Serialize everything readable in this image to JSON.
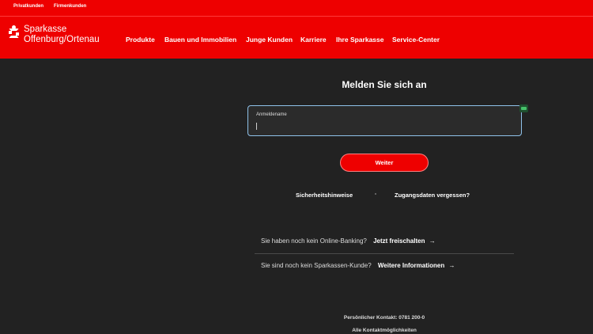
{
  "topbar": {
    "segments": [
      {
        "label": "Privatkunden"
      },
      {
        "label": "Firmenkunden"
      }
    ]
  },
  "brand": {
    "line1": "Sparkasse",
    "line2": "Offenburg/Ortenau",
    "color": "#ee0000"
  },
  "nav": {
    "items": [
      {
        "label": "Produkte"
      },
      {
        "label": "Bauen und Immobilien"
      },
      {
        "label": "Junge Kunden"
      },
      {
        "label": "Karriere"
      },
      {
        "label": "Ihre Sparkasse"
      },
      {
        "label": "Service-Center"
      }
    ]
  },
  "login": {
    "title": "Melden Sie sich an",
    "username_label": "Anmeldename",
    "username_value": "",
    "submit_label": "Weiter"
  },
  "links": {
    "security": "Sicherheitshinweise",
    "forgot": "Zugangsdaten vergessen?"
  },
  "rows": [
    {
      "text": "Sie haben noch kein Online-Banking?",
      "cta": "Jetzt freischalten",
      "arrow": "→"
    },
    {
      "text": "Sie sind noch kein Sparkassen-Kunde?",
      "cta": "Weitere Informationen",
      "arrow": "→"
    }
  ],
  "footer": {
    "contact": "Persönlicher Kontakt: 0781 200-0",
    "all_contacts": "Alle Kontaktmöglichkeiten"
  },
  "icons": {
    "brand_logo": "sparkasse-s-icon",
    "password_manager": "password-manager-icon",
    "arrow": "arrow-right-icon"
  }
}
